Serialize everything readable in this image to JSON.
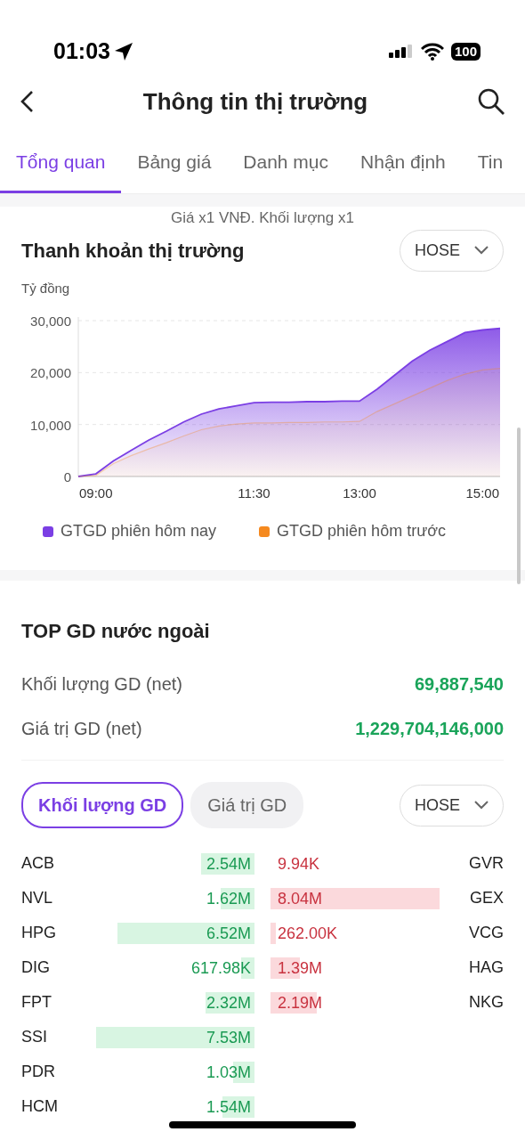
{
  "status_bar": {
    "time": "01:03",
    "battery": "100"
  },
  "header": {
    "title": "Thông tin thị trường"
  },
  "tabs": [
    {
      "label": "Tổng quan",
      "selected": true
    },
    {
      "label": "Bảng giá",
      "selected": false
    },
    {
      "label": "Danh mục",
      "selected": false
    },
    {
      "label": "Nhận định",
      "selected": false
    },
    {
      "label": "Tin",
      "selected": false
    }
  ],
  "liquidity": {
    "note": "Giá x1 VNĐ. Khối lượng x1",
    "title": "Thanh khoản thị trường",
    "exchange": "HOSE",
    "unit": "Tỷ đồng",
    "chart_data": {
      "type": "area",
      "categories": [
        null,
        "09:00",
        null,
        null,
        null,
        null,
        null,
        null,
        null,
        null,
        "11:30",
        null,
        null,
        null,
        null,
        null,
        "13:00",
        null,
        null,
        null,
        null,
        null,
        null,
        "15:00",
        null
      ],
      "ylim": [
        0,
        30000
      ],
      "yticks": [
        {
          "value": 0,
          "label": "0"
        },
        {
          "value": 10000,
          "label": "10,000"
        },
        {
          "value": 20000,
          "label": "20,000"
        },
        {
          "value": 30000,
          "label": "30,000"
        }
      ],
      "series": [
        {
          "name": "GTGD phiên hôm nay",
          "color": "#7b3fe4",
          "values": [
            0,
            500,
            3000,
            5000,
            7000,
            8700,
            10500,
            12000,
            13000,
            13600,
            14200,
            14300,
            14300,
            14400,
            14400,
            14500,
            14500,
            16800,
            19500,
            22200,
            24300,
            26000,
            27700,
            28200,
            28500
          ]
        },
        {
          "name": "GTGD phiên hôm trước",
          "color": "#f5891f",
          "values": [
            0,
            200,
            2500,
            4000,
            5300,
            6500,
            7800,
            9000,
            9700,
            10100,
            10300,
            10300,
            10400,
            10400,
            10500,
            10500,
            10600,
            12500,
            14000,
            15500,
            17000,
            18500,
            19700,
            20500,
            20800
          ]
        }
      ]
    }
  },
  "foreign": {
    "title": "TOP GD nước ngoài",
    "stats": [
      {
        "label": "Khối lượng GD (net)",
        "value": "69,887,540"
      },
      {
        "label": "Giá trị GD (net)",
        "value": "1,229,704,146,000"
      }
    ],
    "filters": [
      {
        "label": "Khối lượng GD",
        "selected": true
      },
      {
        "label": "Giá trị GD",
        "selected": false
      }
    ],
    "exchange": "HOSE",
    "rows": [
      {
        "buy": {
          "symbol": "ACB",
          "value": "2.54M"
        },
        "sell": {
          "symbol": "GVR",
          "value": "9.94K"
        }
      },
      {
        "buy": {
          "symbol": "NVL",
          "value": "1.62M"
        },
        "sell": {
          "symbol": "GEX",
          "value": "8.04M"
        }
      },
      {
        "buy": {
          "symbol": "HPG",
          "value": "6.52M"
        },
        "sell": {
          "symbol": "VCG",
          "value": "262.00K"
        }
      },
      {
        "buy": {
          "symbol": "DIG",
          "value": "617.98K"
        },
        "sell": {
          "symbol": "HAG",
          "value": "1.39M"
        }
      },
      {
        "buy": {
          "symbol": "FPT",
          "value": "2.32M"
        },
        "sell": {
          "symbol": "NKG",
          "value": "2.19M"
        }
      },
      {
        "buy": {
          "symbol": "SSI",
          "value": "7.53M"
        }
      },
      {
        "buy": {
          "symbol": "PDR",
          "value": "1.03M"
        }
      },
      {
        "buy": {
          "symbol": "HCM",
          "value": "1.54M"
        }
      }
    ]
  }
}
